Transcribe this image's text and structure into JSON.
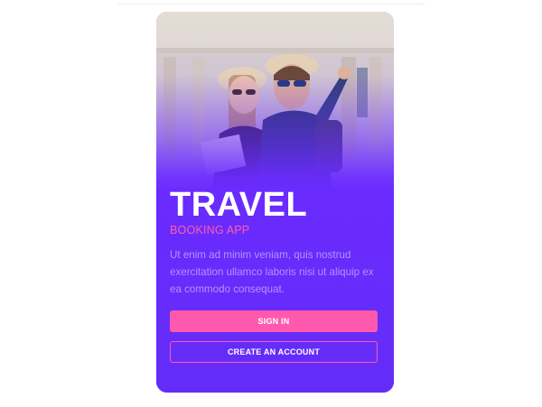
{
  "hero": {
    "title": "TRAVEL",
    "subtitle": "BOOKING APP",
    "description": "Ut enim ad minim veniam, quis nostrud exercitation ullamco laboris nisi ut aliquip ex ea commodo consequat."
  },
  "actions": {
    "sign_in_label": "SIGN IN",
    "create_account_label": "CREATE AN ACCOUNT"
  },
  "colors": {
    "card_background": "#6b2bff",
    "accent": "#ff59ad",
    "title_text": "#ffffff",
    "description_text": "#b493ff"
  }
}
